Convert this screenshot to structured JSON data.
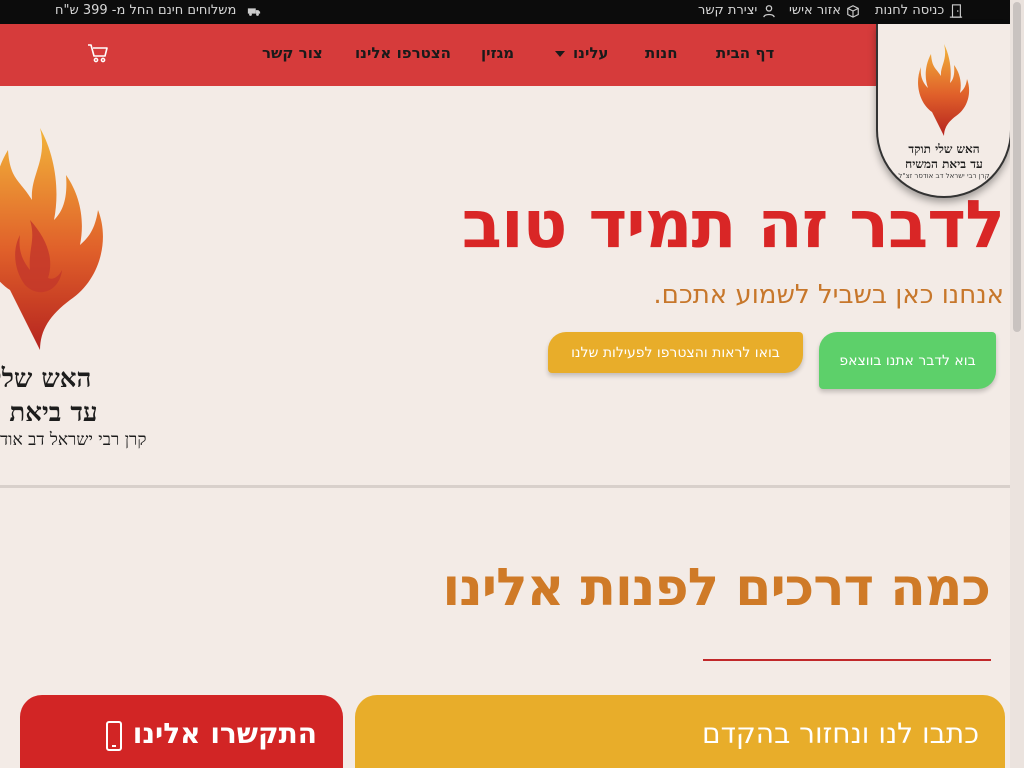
{
  "topbar": {
    "shipping": "משלוחים חינם החל מ- 399 ש\"ח",
    "contact_create": "יצירת קשר",
    "personal_area": "אזור אישי",
    "store_login": "כניסה לחנות"
  },
  "nav": {
    "home": "דף הבית",
    "store": "חנות",
    "about": "עלינו",
    "magazine": "מגזין",
    "join_us": "הצטרפו אלינו",
    "contact": "צור קשר"
  },
  "logo": {
    "line1": "האש שלי תוקד",
    "line2": "עד ביאת המשיח",
    "line3": "קרן רבי ישראל דב אודסר זצ\"ל"
  },
  "big_logo": {
    "line1": "האש שלי ת",
    "line2": "עד ביאת המ",
    "line3": "קרן רבי ישראל דב אוד"
  },
  "hero": {
    "title": "לדבר זה תמיד טוב",
    "subtitle": "אנחנו כאן בשביל לשמוע אתכם.",
    "btn_whatsapp": "בוא לדבר אתנו בווצאפ",
    "btn_activities": "בואו לראות והצטרפו לפעילות שלנו"
  },
  "ways": {
    "title": "כמה דרכים לפנות אלינו",
    "card_write": "כתבו לנו ונחזור בהקדם",
    "card_call": "התקשרו אלינו"
  },
  "colors": {
    "nav_red": "#d63b3b",
    "hero_red": "#d92626",
    "orange": "#c7772b",
    "yellow": "#e8ad2a",
    "green": "#5dd06a",
    "background": "#f3ebe6"
  }
}
